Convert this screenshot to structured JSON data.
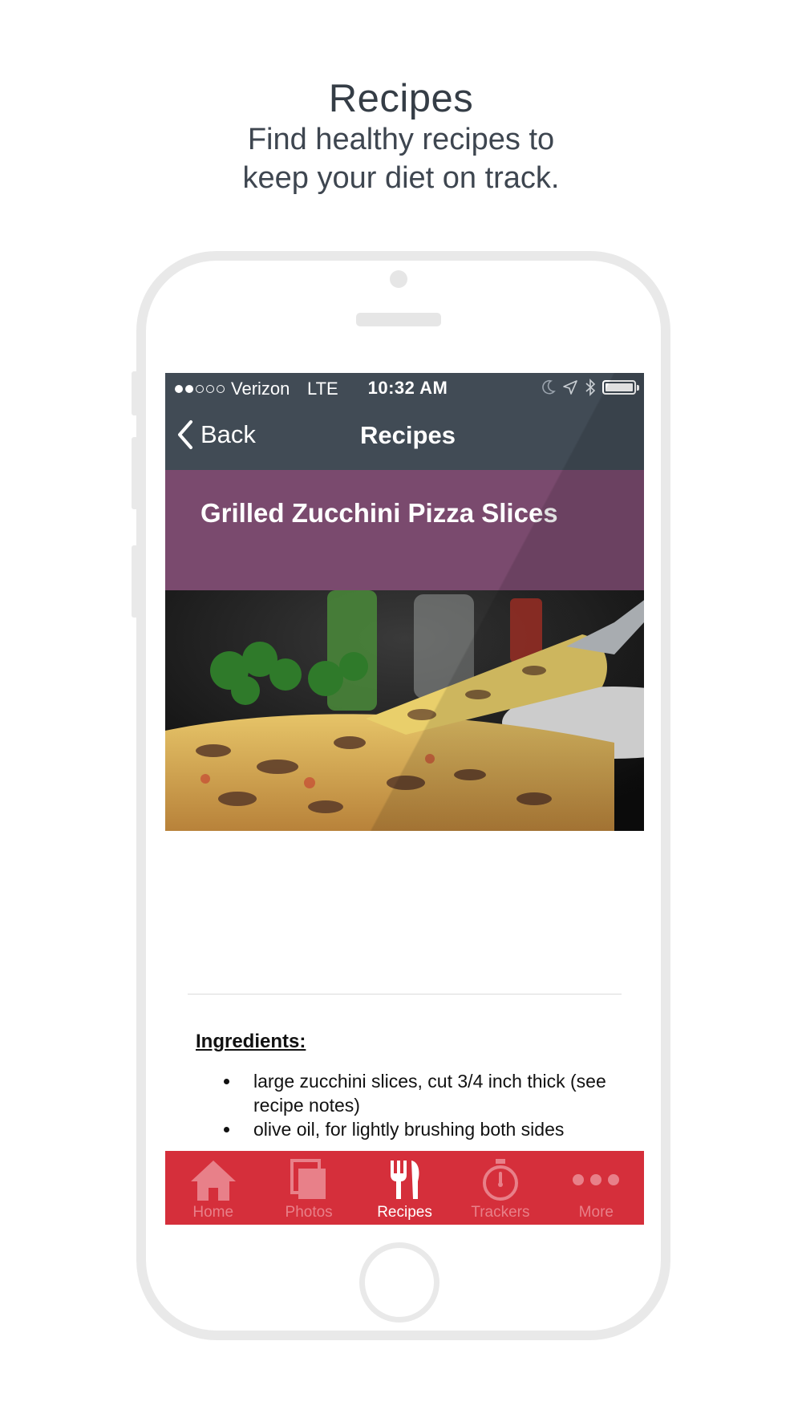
{
  "promo": {
    "title": "Recipes",
    "subtitle_line1": "Find healthy recipes to",
    "subtitle_line2": "keep your diet on track."
  },
  "status_bar": {
    "carrier": "Verizon",
    "network": "LTE",
    "time": "10:32 AM",
    "signal_bars_filled": 2,
    "signal_bars_total": 5
  },
  "nav": {
    "back_label": "Back",
    "title": "Recipes"
  },
  "recipe": {
    "title": "Grilled Zucchini Pizza Slices",
    "ingredients_heading": "Ingredients:",
    "ingredients": [
      "large zucchini slices, cut 3/4 inch thick (see recipe notes)",
      "olive oil, for lightly brushing both sides"
    ]
  },
  "tabs": [
    {
      "label": "Home",
      "icon": "house-icon",
      "active": false
    },
    {
      "label": "Photos",
      "icon": "photos-icon",
      "active": false
    },
    {
      "label": "Recipes",
      "icon": "fork-knife-icon",
      "active": true
    },
    {
      "label": "Trackers",
      "icon": "stopwatch-icon",
      "active": false
    },
    {
      "label": "More",
      "icon": "more-dots-icon",
      "active": false
    }
  ],
  "colors": {
    "nav_bg": "#414b55",
    "recipe_header_bg": "#7a4a6e",
    "tab_bar_bg": "#d52f3b",
    "tab_inactive": "#e88089",
    "tab_active": "#ffffff"
  }
}
